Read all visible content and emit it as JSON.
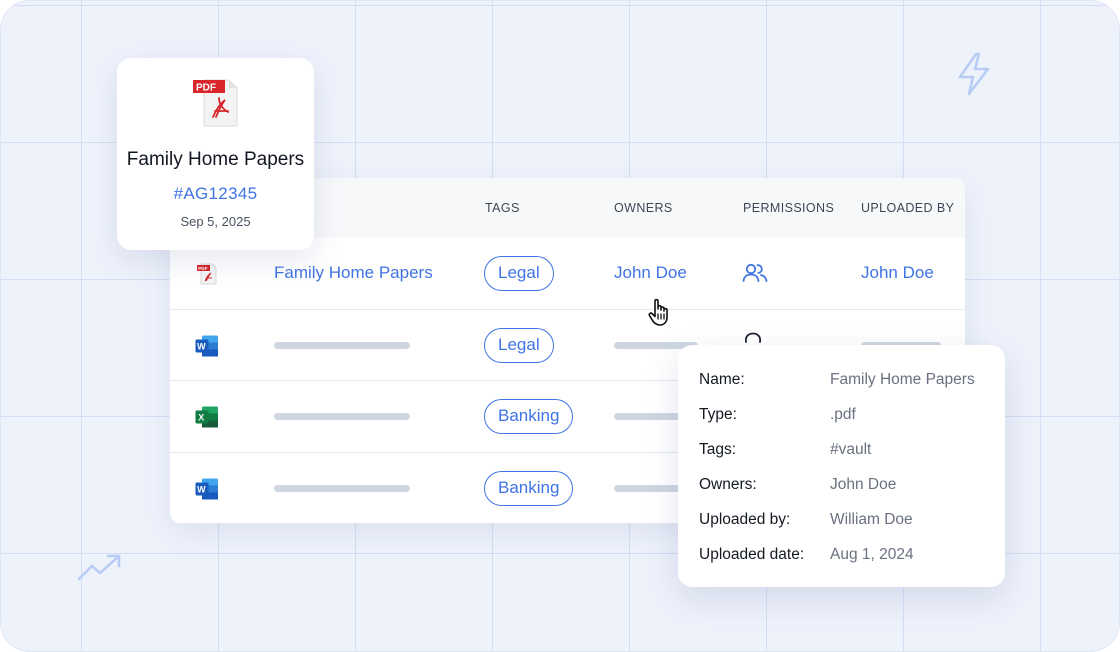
{
  "table": {
    "headers": {
      "tags": "TAGS",
      "owners": "OWNERS",
      "permissions": "PERMISSIONS",
      "uploaded_by": "UPLOADED BY"
    },
    "rows": [
      {
        "file_type": "pdf",
        "name": "Family Home Papers",
        "tag": "Legal",
        "owner": "John Doe",
        "uploaded_by": "John Doe"
      },
      {
        "file_type": "word",
        "name": "",
        "tag": "Legal"
      },
      {
        "file_type": "excel",
        "name": "",
        "tag": "Banking"
      },
      {
        "file_type": "word",
        "name": "",
        "tag": "Banking"
      }
    ]
  },
  "doc_card": {
    "title": "Family Home Papers",
    "id": "#AG12345",
    "date": "Sep 5, 2025"
  },
  "details": {
    "rows": [
      {
        "label": "Name:",
        "value": "Family Home Papers"
      },
      {
        "label": "Type:",
        "value": ".pdf"
      },
      {
        "label": "Tags:",
        "value": "#vault"
      },
      {
        "label": "Owners:",
        "value": "John Doe"
      },
      {
        "label": "Uploaded by:",
        "value": "William Doe"
      },
      {
        "label": "Uploaded date:",
        "value": "Aug 1, 2024"
      }
    ]
  },
  "icons": {
    "pdf": "pdf-file-icon",
    "word": "word-file-icon",
    "excel": "excel-file-icon",
    "permissions": "users-icon",
    "cursor": "hand-pointer-icon",
    "decor_top": "lightning-icon",
    "decor_bottom": "trend-up-icon"
  },
  "colors": {
    "accent": "#3f74e4",
    "background": "#eef2fb",
    "pdf_red": "#d9262b",
    "word_blue": "#185abd",
    "excel_green": "#1d7044"
  }
}
